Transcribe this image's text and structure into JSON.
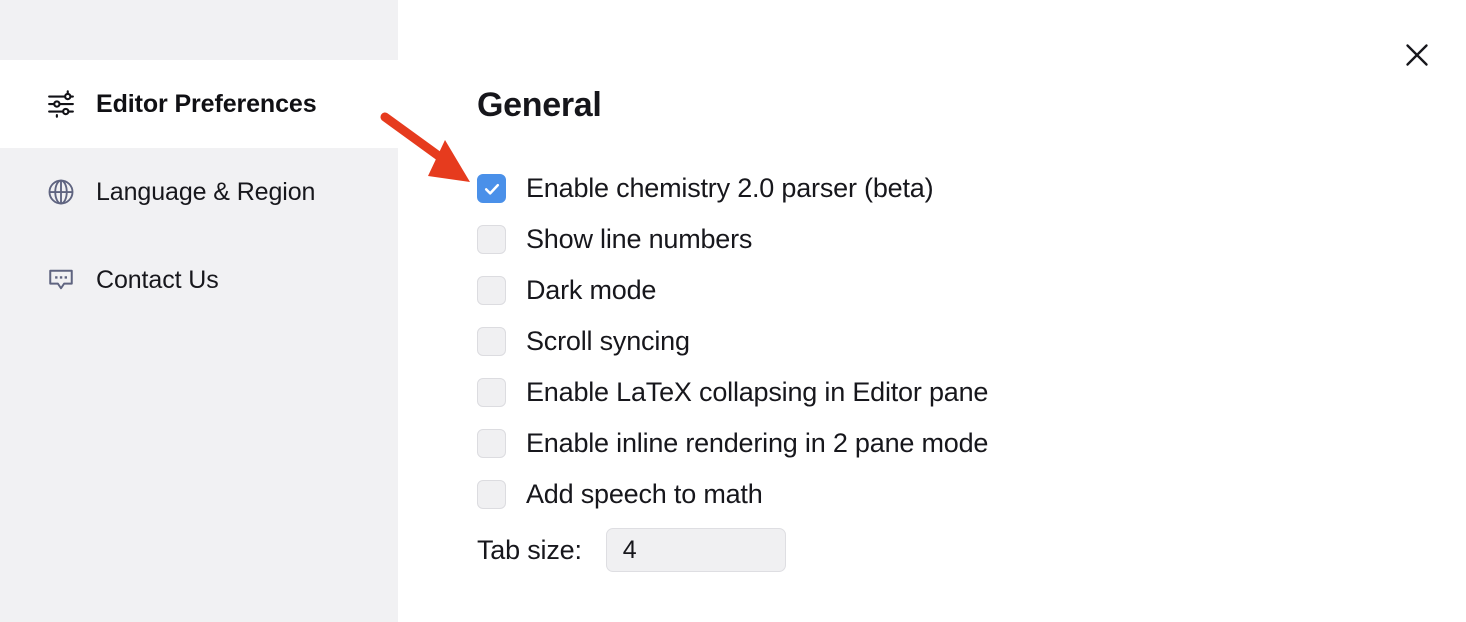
{
  "window": {
    "close_label": "X"
  },
  "sidebar": {
    "items": [
      {
        "label": "Editor Preferences",
        "icon": "sliders-icon",
        "active": true
      },
      {
        "label": "Language & Region",
        "icon": "globe-icon",
        "active": false
      },
      {
        "label": "Contact Us",
        "icon": "chat-bubble-icon",
        "active": false
      }
    ]
  },
  "main": {
    "title": "General",
    "options": [
      {
        "label": "Enable chemistry 2.0 parser (beta)",
        "checked": true
      },
      {
        "label": "Show line numbers",
        "checked": false
      },
      {
        "label": "Dark mode",
        "checked": false
      },
      {
        "label": "Scroll syncing",
        "checked": false
      },
      {
        "label": "Enable LaTeX collapsing in Editor pane",
        "checked": false
      },
      {
        "label": "Enable inline rendering in 2 pane mode",
        "checked": false
      },
      {
        "label": "Add speech to math",
        "checked": false
      }
    ],
    "tab_size": {
      "label": "Tab size:",
      "value": "4"
    }
  },
  "annotation": {
    "arrow_color": "#e63b1e",
    "points_at": "Enable chemistry 2.0 parser (beta)"
  },
  "colors": {
    "sidebar_bg": "#f1f1f3",
    "panel_bg": "#ffffff",
    "checkbox_checked": "#4a90e9",
    "checkbox_unchecked": "#f0f0f2",
    "text": "#17171c",
    "icon_muted": "#5f6480"
  }
}
